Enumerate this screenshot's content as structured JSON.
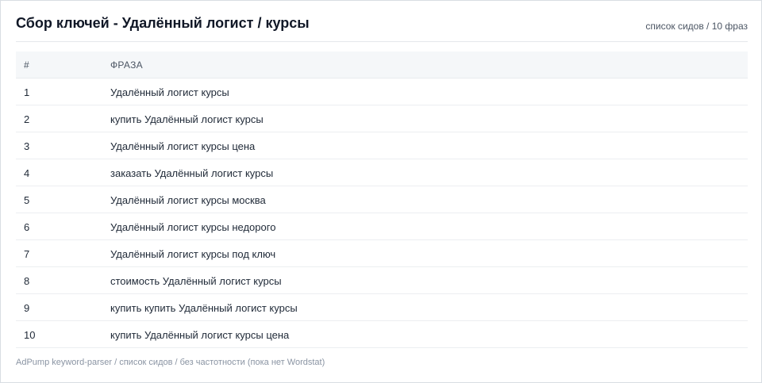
{
  "header": {
    "title": "Сбор ключей - Удалённый логист / курсы",
    "subtitle": "список сидов / 10 фраз"
  },
  "table": {
    "columns": [
      "#",
      "ФРАЗА"
    ],
    "rows": [
      {
        "num": "1",
        "phrase": "Удалённый логист курсы"
      },
      {
        "num": "2",
        "phrase": "купить Удалённый логист курсы"
      },
      {
        "num": "3",
        "phrase": "Удалённый логист курсы цена"
      },
      {
        "num": "4",
        "phrase": "заказать Удалённый логист курсы"
      },
      {
        "num": "5",
        "phrase": "Удалённый логист курсы москва"
      },
      {
        "num": "6",
        "phrase": "Удалённый логист курсы недорого"
      },
      {
        "num": "7",
        "phrase": "Удалённый логист курсы под ключ"
      },
      {
        "num": "8",
        "phrase": "стоимость Удалённый логист курсы"
      },
      {
        "num": "9",
        "phrase": "купить купить Удалённый логист курсы"
      },
      {
        "num": "10",
        "phrase": "купить Удалённый логист курсы цена"
      }
    ]
  },
  "footer": {
    "text": "AdPump keyword-parser / список сидов / без частотности (пока нет Wordstat)"
  }
}
